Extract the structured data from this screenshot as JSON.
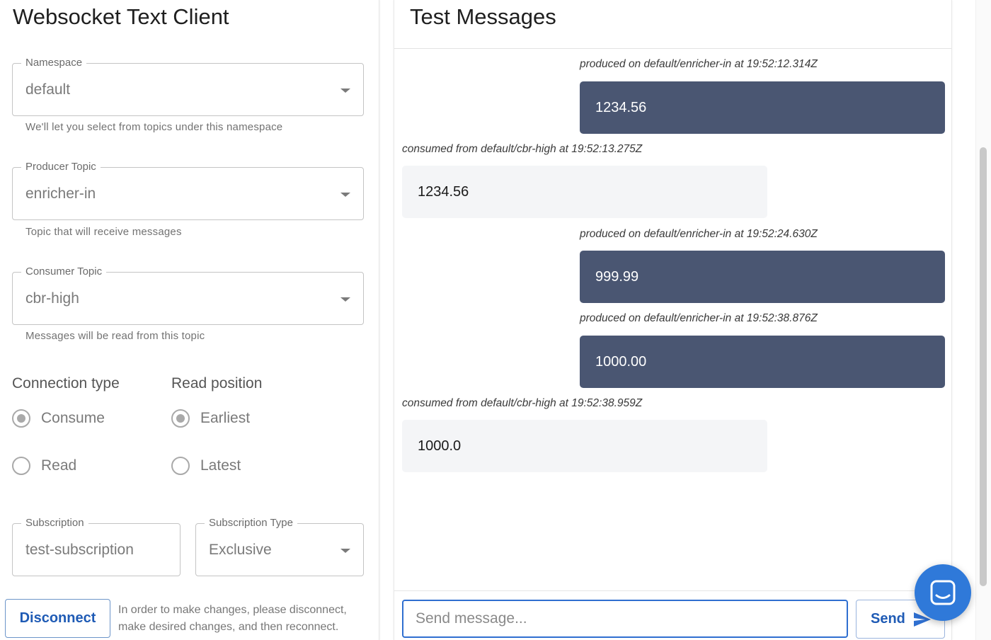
{
  "left": {
    "title": "Websocket Text Client",
    "namespace": {
      "legend": "Namespace",
      "value": "default",
      "helper": "We'll let you select from topics under this namespace"
    },
    "producer_topic": {
      "legend": "Producer Topic",
      "value": "enricher-in",
      "helper": "Topic that will receive messages"
    },
    "consumer_topic": {
      "legend": "Consumer Topic",
      "value": "cbr-high",
      "helper": "Messages will be read from this topic"
    },
    "connection_type": {
      "label": "Connection type",
      "options": [
        "Consume",
        "Read"
      ],
      "selected": "Consume"
    },
    "read_position": {
      "label": "Read position",
      "options": [
        "Earliest",
        "Latest"
      ],
      "selected": "Earliest"
    },
    "subscription": {
      "legend": "Subscription",
      "value": "test-subscription"
    },
    "subscription_type": {
      "legend": "Subscription Type",
      "value": "Exclusive"
    },
    "disconnect_label": "Disconnect",
    "note": "In order to make changes, please disconnect, make desired changes, and then reconnect."
  },
  "right": {
    "title": "Test Messages",
    "messages": [
      {
        "kind": "produced",
        "meta": "produced on default/enricher-in at 19:52:12.314Z",
        "body": "1234.56"
      },
      {
        "kind": "consumed",
        "meta": "consumed from default/cbr-high at 19:52:13.275Z",
        "body": "1234.56"
      },
      {
        "kind": "produced",
        "meta": "produced on default/enricher-in at 19:52:24.630Z",
        "body": "999.99"
      },
      {
        "kind": "produced",
        "meta": "produced on default/enricher-in at 19:52:38.876Z",
        "body": "1000.00"
      },
      {
        "kind": "consumed",
        "meta": "consumed from default/cbr-high at 19:52:38.959Z",
        "body": "1000.0"
      }
    ],
    "composer": {
      "placeholder": "Send message...",
      "send_label": "Send"
    }
  },
  "colors": {
    "accent": "#2f6fd0",
    "produced_bubble": "#4a5672",
    "consumed_bubble": "#f4f5f7",
    "launcher": "#2f79d9"
  },
  "icons": {
    "dropdown": "caret-down-icon",
    "send": "send-icon",
    "chat": "chat-icon"
  }
}
